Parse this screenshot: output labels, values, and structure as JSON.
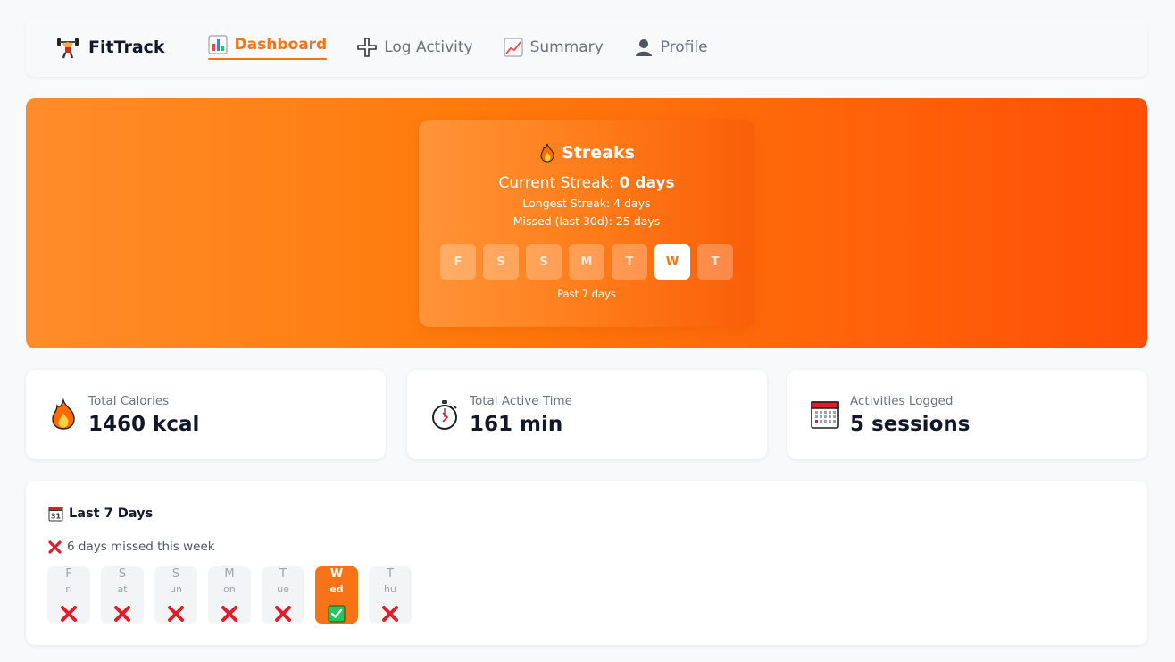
{
  "app": {
    "name": "FitTrack"
  },
  "nav": {
    "items": [
      {
        "label": "Dashboard",
        "icon": "bar-chart-icon",
        "active": true
      },
      {
        "label": "Log Activity",
        "icon": "plus-icon",
        "active": false
      },
      {
        "label": "Summary",
        "icon": "line-chart-icon",
        "active": false
      },
      {
        "label": "Profile",
        "icon": "person-icon",
        "active": false
      }
    ]
  },
  "streaks": {
    "title": "Streaks",
    "current_prefix": "Current Streak:",
    "current_value": "0 days",
    "longest": "Longest Streak: 4 days",
    "missed": "Missed (last 30d): 25 days",
    "days": [
      {
        "letter": "F",
        "active": false
      },
      {
        "letter": "S",
        "active": false
      },
      {
        "letter": "S",
        "active": false
      },
      {
        "letter": "M",
        "active": false
      },
      {
        "letter": "T",
        "active": false
      },
      {
        "letter": "W",
        "active": true
      },
      {
        "letter": "T",
        "active": false
      }
    ],
    "caption": "Past 7 days"
  },
  "stats": [
    {
      "label": "Total Calories",
      "value": "1460 kcal",
      "icon": "fire-icon"
    },
    {
      "label": "Total Active Time",
      "value": "161 min",
      "icon": "stopwatch-icon"
    },
    {
      "label": "Activities Logged",
      "value": "5 sessions",
      "icon": "calendar-icon"
    }
  ],
  "week": {
    "title": "Last 7 Days",
    "missed_text": "6 days missed this week",
    "days": [
      {
        "l1": "F",
        "l2": "ri",
        "done": false
      },
      {
        "l1": "S",
        "l2": "at",
        "done": false
      },
      {
        "l1": "S",
        "l2": "un",
        "done": false
      },
      {
        "l1": "M",
        "l2": "on",
        "done": false
      },
      {
        "l1": "T",
        "l2": "ue",
        "done": false
      },
      {
        "l1": "W",
        "l2": "ed",
        "done": true
      },
      {
        "l1": "T",
        "l2": "hu",
        "done": false
      }
    ]
  },
  "colors": {
    "accent": "#f97316",
    "missed": "#e11d2a",
    "done": "#22c55e"
  }
}
